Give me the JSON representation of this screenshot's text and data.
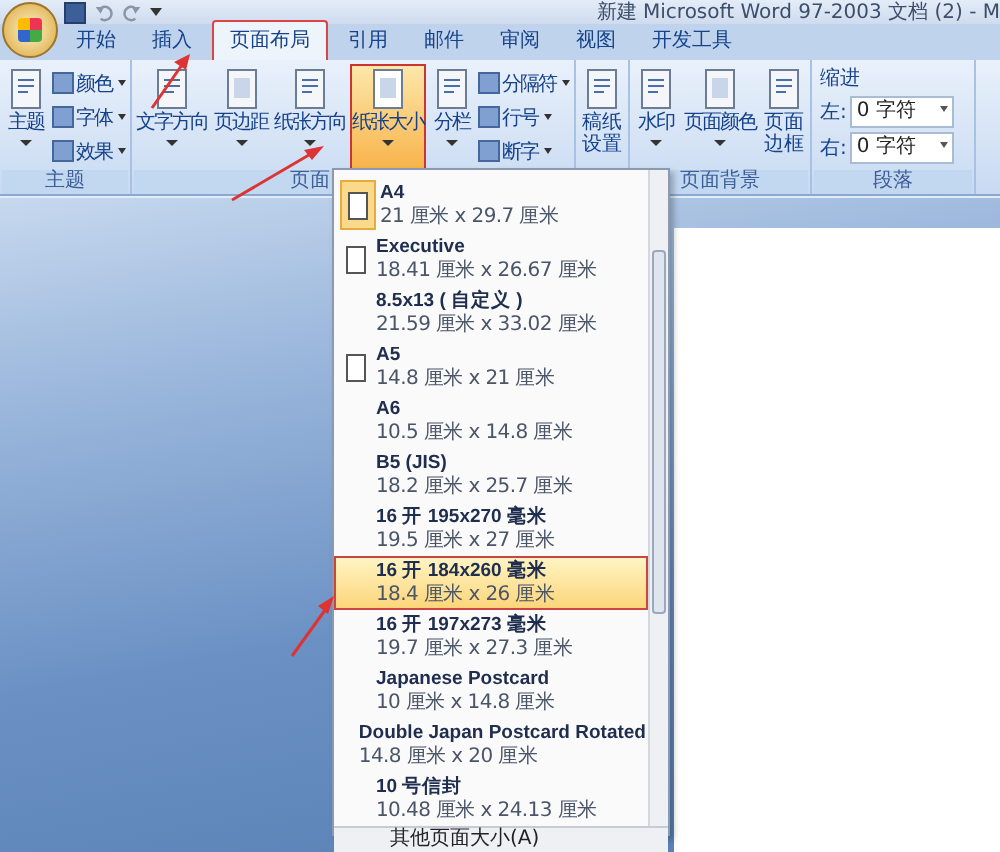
{
  "window": {
    "title": "新建 Microsoft Word 97-2003 文档 (2) - M"
  },
  "tabs": [
    {
      "label": "开始",
      "selected": false
    },
    {
      "label": "插入",
      "selected": false
    },
    {
      "label": "页面布局",
      "selected": true
    },
    {
      "label": "引用",
      "selected": false
    },
    {
      "label": "邮件",
      "selected": false
    },
    {
      "label": "审阅",
      "selected": false
    },
    {
      "label": "视图",
      "selected": false
    },
    {
      "label": "开发工具",
      "selected": false
    }
  ],
  "ribbon": {
    "groups": [
      {
        "label": "主题",
        "items": [
          {
            "kind": "large",
            "label": "主题",
            "dropdown": true,
            "selected": false
          },
          {
            "kind": "column",
            "buttons": [
              {
                "label": "颜色",
                "dropdown": true
              },
              {
                "label": "字体",
                "dropdown": true
              },
              {
                "label": "效果",
                "dropdown": true
              }
            ]
          }
        ]
      },
      {
        "label": "页面",
        "items": [
          {
            "kind": "large",
            "label": "文字方向",
            "dropdown": true,
            "selected": false
          },
          {
            "kind": "large",
            "label": "页边距",
            "dropdown": true,
            "selected": false
          },
          {
            "kind": "large",
            "label": "纸张方向",
            "dropdown": true,
            "selected": false
          },
          {
            "kind": "large",
            "label": "纸张大小",
            "dropdown": true,
            "selected": true
          },
          {
            "kind": "large",
            "label": "分栏",
            "dropdown": true,
            "selected": false
          },
          {
            "kind": "column",
            "buttons": [
              {
                "label": "分隔符",
                "dropdown": true
              },
              {
                "label": "行号",
                "dropdown": true
              },
              {
                "label": "断字",
                "dropdown": true
              }
            ]
          }
        ]
      },
      {
        "items": [
          {
            "kind": "tall",
            "label": "稿纸设置",
            "dropdown": false,
            "selected": false
          }
        ]
      },
      {
        "label": "页面背景",
        "items": [
          {
            "kind": "large",
            "label": "水印",
            "dropdown": true,
            "selected": false
          },
          {
            "kind": "large",
            "label": "页面颜色",
            "dropdown": true,
            "selected": false
          },
          {
            "kind": "tall",
            "label": "页面边框",
            "dropdown": false,
            "selected": false
          }
        ]
      },
      {
        "label": "段落",
        "items": [
          {
            "kind": "spin",
            "title": "缩进",
            "fields": [
              {
                "label": "左:",
                "value": "0 字符"
              },
              {
                "label": "右:",
                "value": "0 字符"
              }
            ]
          }
        ]
      }
    ]
  },
  "paper_menu": {
    "items": [
      {
        "name": "A4",
        "size": "21 厘米 x 29.7 厘米",
        "icon": true,
        "current": true,
        "selected": false
      },
      {
        "name": "Executive",
        "size": "18.41 厘米 x 26.67 厘米",
        "icon": true,
        "current": false,
        "selected": false
      },
      {
        "name": "8.5x13 ( 自定义 )",
        "size": "21.59 厘米 x 33.02 厘米",
        "icon": false,
        "current": false,
        "selected": false
      },
      {
        "name": "A5",
        "size": "14.8 厘米 x 21 厘米",
        "icon": true,
        "current": false,
        "selected": false
      },
      {
        "name": "A6",
        "size": "10.5 厘米 x 14.8 厘米",
        "icon": false,
        "current": false,
        "selected": false
      },
      {
        "name": "B5 (JIS)",
        "size": "18.2 厘米 x 25.7 厘米",
        "icon": false,
        "current": false,
        "selected": false
      },
      {
        "name": "16 开 195x270 毫米",
        "size": "19.5 厘米 x 27 厘米",
        "icon": false,
        "current": false,
        "selected": false
      },
      {
        "name": "16 开 184x260 毫米",
        "size": "18.4 厘米 x 26 厘米",
        "icon": false,
        "current": false,
        "selected": true
      },
      {
        "name": "16 开 197x273 毫米",
        "size": "19.7 厘米 x 27.3 厘米",
        "icon": false,
        "current": false,
        "selected": false
      },
      {
        "name": "Japanese Postcard",
        "size": "10 厘米 x 14.8 厘米",
        "icon": false,
        "current": false,
        "selected": false
      },
      {
        "name": "Double Japan Postcard Rotated",
        "size": "14.8 厘米 x 20 厘米",
        "icon": false,
        "current": false,
        "selected": false
      },
      {
        "name": "10 号信封",
        "size": "10.48 厘米 x 24.13 厘米",
        "icon": false,
        "current": false,
        "selected": false
      }
    ],
    "footer": "其他页面大小(A)"
  }
}
